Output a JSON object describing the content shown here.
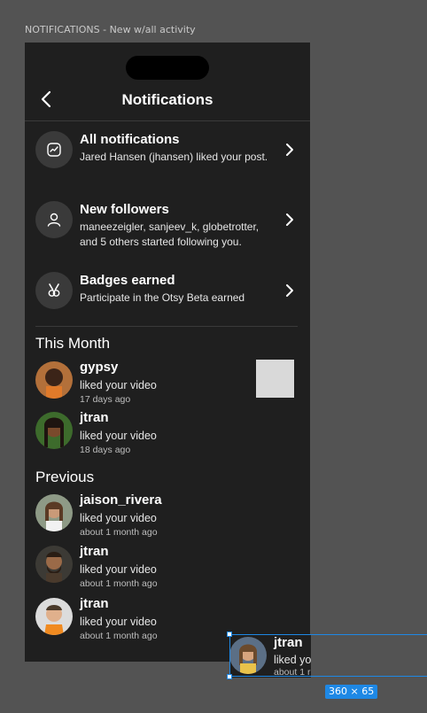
{
  "canvas": {
    "frame_label": "NOTIFICATIONS - New w/all activity"
  },
  "header": {
    "title": "Notifications"
  },
  "summaries": [
    {
      "title": "All notifications",
      "desc": "Jared Hansen (jhansen) liked your post.",
      "icon": "activity-icon"
    },
    {
      "title": "New followers",
      "desc": "maneezeigler, sanjeev_k, globetrotter, and 5 others started following you.",
      "icon": "user-icon"
    },
    {
      "title": "Badges earned",
      "desc": "Participate in the Otsy Beta earned",
      "icon": "medal-icon"
    }
  ],
  "sections": {
    "this_month": "This Month",
    "previous": "Previous"
  },
  "this_month_items": [
    {
      "user": "gypsy",
      "action": "liked your video",
      "time": "17 days ago"
    },
    {
      "user": "jtran",
      "action": "liked your video",
      "time": "18 days ago"
    }
  ],
  "previous_items": [
    {
      "user": "jaison_rivera",
      "action": "liked your video",
      "time": "about 1 month ago"
    },
    {
      "user": "jtran",
      "action": "liked your video",
      "time": "about 1 month ago"
    },
    {
      "user": "jtran",
      "action": "liked your video",
      "time": "about 1 month ago"
    }
  ],
  "drag_ghost": {
    "user": "jtran",
    "action": "liked yo",
    "time": "about 1 r"
  },
  "selection": {
    "size_label": "360 × 65"
  },
  "colors": {
    "background": "#535353",
    "phone": "#1f1f1f",
    "selection": "#1e88e5"
  }
}
